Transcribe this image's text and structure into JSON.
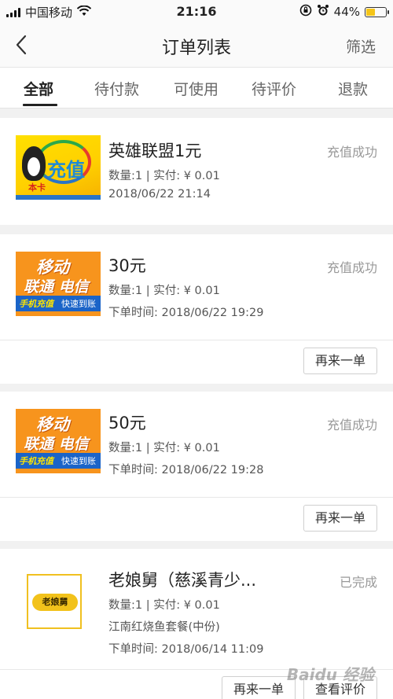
{
  "status_bar": {
    "carrier": "中国移动",
    "time": "21:16",
    "battery": "44%",
    "battery_level": 0.44,
    "icons": [
      "signal-icon",
      "wifi-icon",
      "rotation-lock-icon",
      "alarm-icon",
      "battery-icon"
    ]
  },
  "nav": {
    "title": "订单列表",
    "filter_label": "筛选",
    "back_icon": "chevron-left-icon"
  },
  "tabs": [
    {
      "label": "全部",
      "active": true
    },
    {
      "label": "待付款",
      "active": false
    },
    {
      "label": "可使用",
      "active": false
    },
    {
      "label": "待评价",
      "active": false
    },
    {
      "label": "退款",
      "active": false
    }
  ],
  "orders": [
    {
      "title": "英雄联盟1元",
      "status": "充值成功",
      "quantity_paid": "数量:1 | 实付: ¥ 0.01",
      "time": "2018/06/22 21:14",
      "thumb_text": "充值",
      "thumb_sub": "本卡"
    },
    {
      "title": "30元",
      "status": "充值成功",
      "quantity_paid": "数量:1 | 实付: ¥ 0.01",
      "time": "下单时间: 2018/06/22 19:29",
      "thumb_top": "移动",
      "thumb_mid": "联通 电信",
      "thumb_bar_a": "手机充值",
      "thumb_bar_b": "快速到账",
      "action": "再来一单"
    },
    {
      "title": "50元",
      "status": "充值成功",
      "quantity_paid": "数量:1 | 实付: ¥ 0.01",
      "time": "下单时间: 2018/06/22 19:28",
      "thumb_top": "移动",
      "thumb_mid": "联通 电信",
      "thumb_bar_a": "手机充值",
      "thumb_bar_b": "快速到账",
      "action": "再来一单"
    },
    {
      "title": "老娘舅（慈溪青少...",
      "status": "已完成",
      "quantity_paid": "数量:1 | 实付: ¥ 0.01",
      "item": "江南红烧鱼套餐(中份)",
      "time": "下单时间: 2018/06/14 11:09",
      "thumb_logo": "老娘舅",
      "action": "再来一单",
      "action2": "查看评价"
    }
  ],
  "watermark": "Baidu 经验"
}
